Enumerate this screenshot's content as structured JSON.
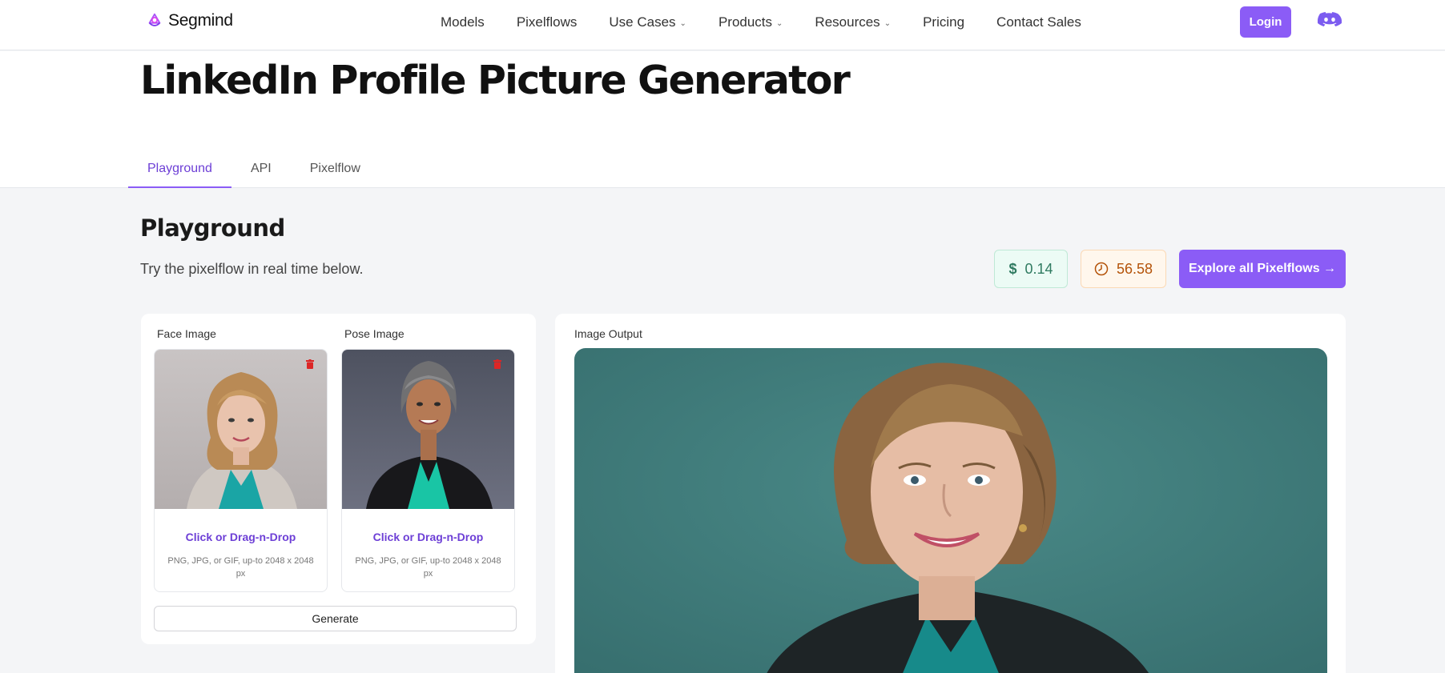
{
  "nav": {
    "brand": "Segmind",
    "items": [
      {
        "label": "Models",
        "dropdown": false
      },
      {
        "label": "Pixelflows",
        "dropdown": false
      },
      {
        "label": "Use Cases",
        "dropdown": true
      },
      {
        "label": "Products",
        "dropdown": true
      },
      {
        "label": "Resources",
        "dropdown": true
      },
      {
        "label": "Pricing",
        "dropdown": false
      },
      {
        "label": "Contact Sales",
        "dropdown": false
      }
    ],
    "login_label": "Login",
    "discord_icon": "discord-icon"
  },
  "hero": {
    "title": "LinkedIn Profile Picture Generator",
    "tabs": [
      {
        "label": "Playground",
        "active": true
      },
      {
        "label": "API",
        "active": false
      },
      {
        "label": "Pixelflow",
        "active": false
      }
    ]
  },
  "playground": {
    "title": "Playground",
    "subtitle": "Try the pixelflow in real time below.",
    "cost": "0.14",
    "cost_symbol": "$",
    "time": "56.58",
    "explore_label": "Explore all Pixelflows →"
  },
  "inputs": [
    {
      "label": "Face Image",
      "drop_title": "Click or Drag-n-Drop",
      "drop_hint": "PNG, JPG, or GIF, up-to 2048 x 2048 px"
    },
    {
      "label": "Pose Image",
      "drop_title": "Click or Drag-n-Drop",
      "drop_hint": "PNG, JPG, or GIF, up-to 2048 x 2048 px"
    }
  ],
  "generate_label": "Generate",
  "output": {
    "label": "Image Output"
  },
  "colors": {
    "accent": "#8b5cf6",
    "accent_text": "#6d3fd6",
    "delete": "#dc2626",
    "output_bg": "#3f7c7c"
  }
}
